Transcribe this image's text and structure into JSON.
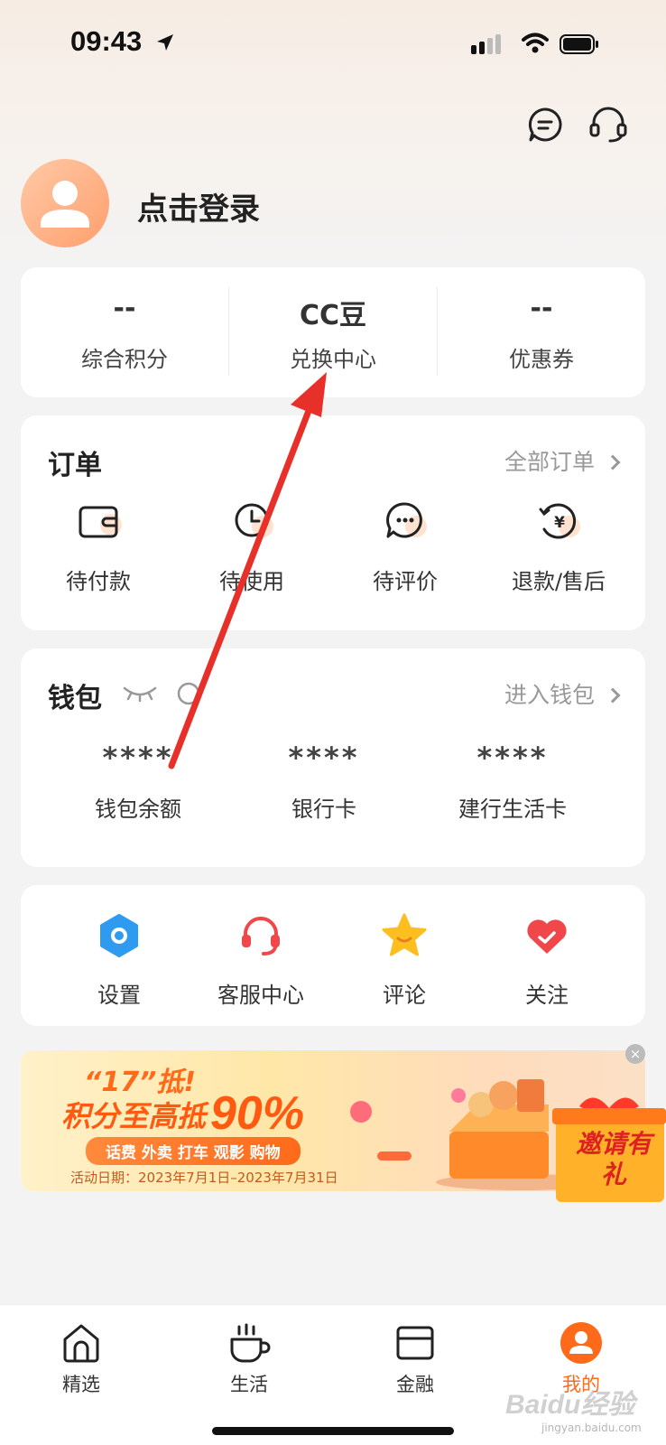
{
  "status_bar": {
    "time": "09:43"
  },
  "profile": {
    "login_text": "点击登录"
  },
  "stats": [
    {
      "value": "--",
      "label": "综合积分"
    },
    {
      "value": "CC豆",
      "label": "兑换中心"
    },
    {
      "value": "--",
      "label": "优惠券"
    }
  ],
  "orders": {
    "title": "订单",
    "link": "全部订单",
    "items": [
      {
        "label": "待付款",
        "icon": "wallet-icon"
      },
      {
        "label": "待使用",
        "icon": "clock-icon"
      },
      {
        "label": "待评价",
        "icon": "chat-icon"
      },
      {
        "label": "退款/售后",
        "icon": "refund-icon"
      }
    ]
  },
  "wallet": {
    "title": "钱包",
    "link": "进入钱包",
    "items": [
      {
        "value": "****",
        "label": "钱包余额"
      },
      {
        "value": "****",
        "label": "银行卡"
      },
      {
        "value": "****",
        "label": "建行生活卡"
      }
    ]
  },
  "services": [
    {
      "label": "设置",
      "icon": "settings-icon"
    },
    {
      "label": "客服中心",
      "icon": "headset-icon"
    },
    {
      "label": "评论",
      "icon": "star-icon"
    },
    {
      "label": "关注",
      "icon": "heart-icon"
    }
  ],
  "banner": {
    "quote": "“17”抵!",
    "headline": "积分至高抵",
    "percent": "90%",
    "pill": "话费 外卖 打车 观影 购物",
    "date": "活动日期：2023年7月1日–2023年7月31日",
    "gift_text": "邀请有礼"
  },
  "bottom_nav": [
    {
      "label": "精选",
      "icon": "home-icon"
    },
    {
      "label": "生活",
      "icon": "cup-icon"
    },
    {
      "label": "金融",
      "icon": "card-icon"
    },
    {
      "label": "我的",
      "icon": "user-icon",
      "active": true
    }
  ],
  "watermark": {
    "brand": "Baidu经验",
    "url": "jingyan.baidu.com"
  },
  "colors": {
    "accent": "#ff6a1a",
    "arrow": "#e8302a"
  }
}
